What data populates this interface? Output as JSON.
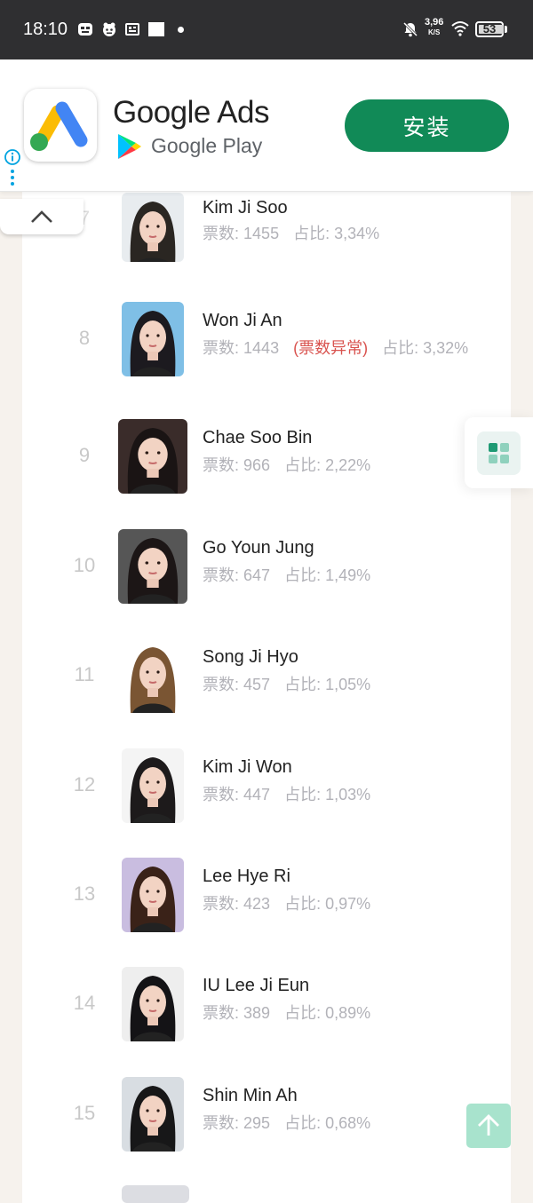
{
  "status_bar": {
    "time": "18:10",
    "net_speed": "3,96",
    "net_speed_unit": "K/S",
    "battery": "53",
    "icons": [
      "bitmoji-icon",
      "app-icon",
      "photo-icon",
      "square-icon",
      "dot-icon",
      "bell-off-icon",
      "wifi-icon",
      "battery-icon"
    ]
  },
  "ad": {
    "title": "Google Ads",
    "subtitle": "Google Play",
    "install_label": "安装",
    "accent": "#118a57"
  },
  "ranking": {
    "vote_prefix": "票数:",
    "share_prefix": "占比:",
    "anomaly_label": "(票数异常)",
    "anomaly_color": "#d9534f",
    "items": [
      {
        "rank": "7",
        "name": "Kim Ji Soo",
        "votes": "1455",
        "share": "3,34%"
      },
      {
        "rank": "8",
        "name": "Won Ji An",
        "votes": "1443",
        "share": "3,32%",
        "anomaly": true
      },
      {
        "rank": "9",
        "name": "Chae Soo Bin",
        "votes": "966",
        "share": "2,22%"
      },
      {
        "rank": "10",
        "name": "Go Youn Jung",
        "votes": "647",
        "share": "1,49%"
      },
      {
        "rank": "11",
        "name": "Song Ji Hyo",
        "votes": "457",
        "share": "1,05%"
      },
      {
        "rank": "12",
        "name": "Kim Ji Won",
        "votes": "447",
        "share": "1,03%"
      },
      {
        "rank": "13",
        "name": "Lee Hye Ri",
        "votes": "423",
        "share": "0,97%"
      },
      {
        "rank": "14",
        "name": "IU Lee Ji Eun",
        "votes": "389",
        "share": "0,89%"
      },
      {
        "rank": "15",
        "name": "Shin Min Ah",
        "votes": "295",
        "share": "0,68%"
      }
    ]
  },
  "colors": {
    "primary": "#118a57",
    "back_to_top": "#a8e3cd",
    "rank_text": "#c8c8c8",
    "stat_text": "#b2b2b8"
  }
}
